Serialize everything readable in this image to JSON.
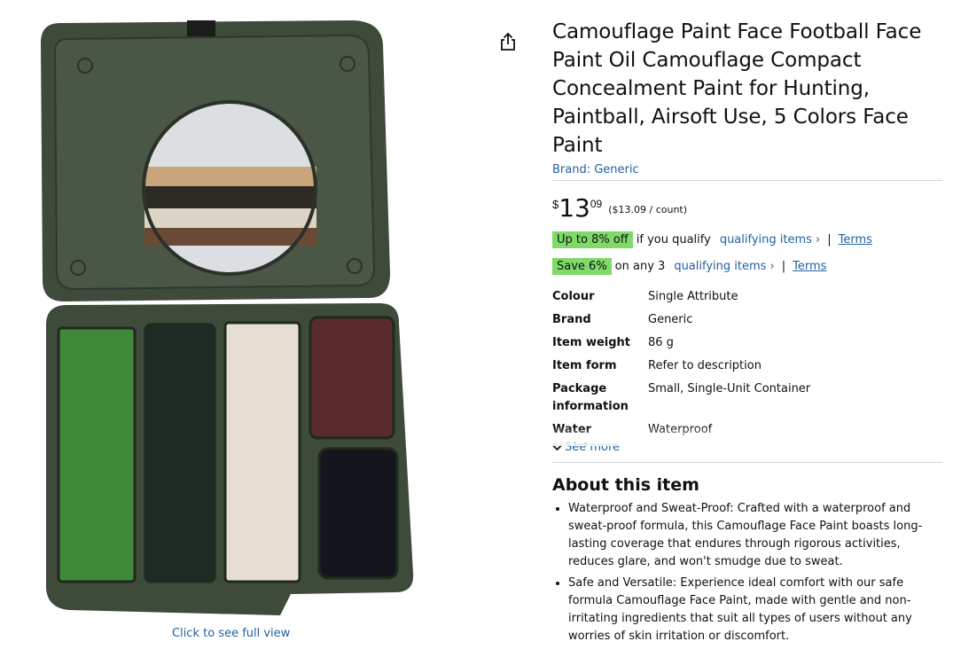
{
  "image": {
    "full_view_label": "Click to see full view",
    "colors": {
      "case": "#3e4a3a",
      "green": "#3f8a3a",
      "dark_green": "#1d2b24",
      "sand": "#e6ddd3",
      "brown": "#5a2b2c",
      "black": "#15151d"
    }
  },
  "product": {
    "title": "Camouflage Paint Face Football Face Paint Oil Camouflage Compact Concealment Paint for Hunting, Paintball, Airsoft Use, 5 Colors Face Paint",
    "brand_link": "Brand: Generic"
  },
  "price": {
    "symbol": "$",
    "whole": "13",
    "fraction": "09",
    "unit": "($13.09 / count)"
  },
  "promos": [
    {
      "badge": "Up to 8% off",
      "text": "if you qualify",
      "link": "qualifying items ›",
      "separator": "|",
      "terms": "Terms"
    },
    {
      "badge": "Save 6%",
      "text": "on any 3",
      "link": "qualifying items ›",
      "separator": "|",
      "terms": "Terms"
    }
  ],
  "specs": [
    {
      "key": "Colour",
      "value": "Single Attribute"
    },
    {
      "key": "Brand",
      "value": "Generic"
    },
    {
      "key": "Item weight",
      "value": "86 g"
    },
    {
      "key": "Item form",
      "value": "Refer to description"
    },
    {
      "key": "Package information",
      "value": "Small, Single-Unit Container"
    },
    {
      "key": "Water resistance level",
      "value": "Waterproof"
    }
  ],
  "see_more_label": "See more",
  "about": {
    "title": "About this item",
    "bullets": [
      "Waterproof and Sweat-Proof: Crafted with a waterproof and sweat-proof formula, this Camouflage Face Paint boasts long-lasting coverage that endures through rigorous activities, reduces glare, and won't smudge due to sweat.",
      "Safe and Versatile: Experience ideal comfort with our safe formula Camouflage Face Paint, made with gentle and non-irritating ingredients that suit all types of users without any worries of skin irritation or discomfort."
    ]
  },
  "icons": {
    "share": "share-icon",
    "chevron": "chevron-down-icon"
  },
  "colors": {
    "link": "#2162a1",
    "badge": "#7fda69",
    "divider": "#d5d9d9",
    "text": "#0f1111"
  }
}
